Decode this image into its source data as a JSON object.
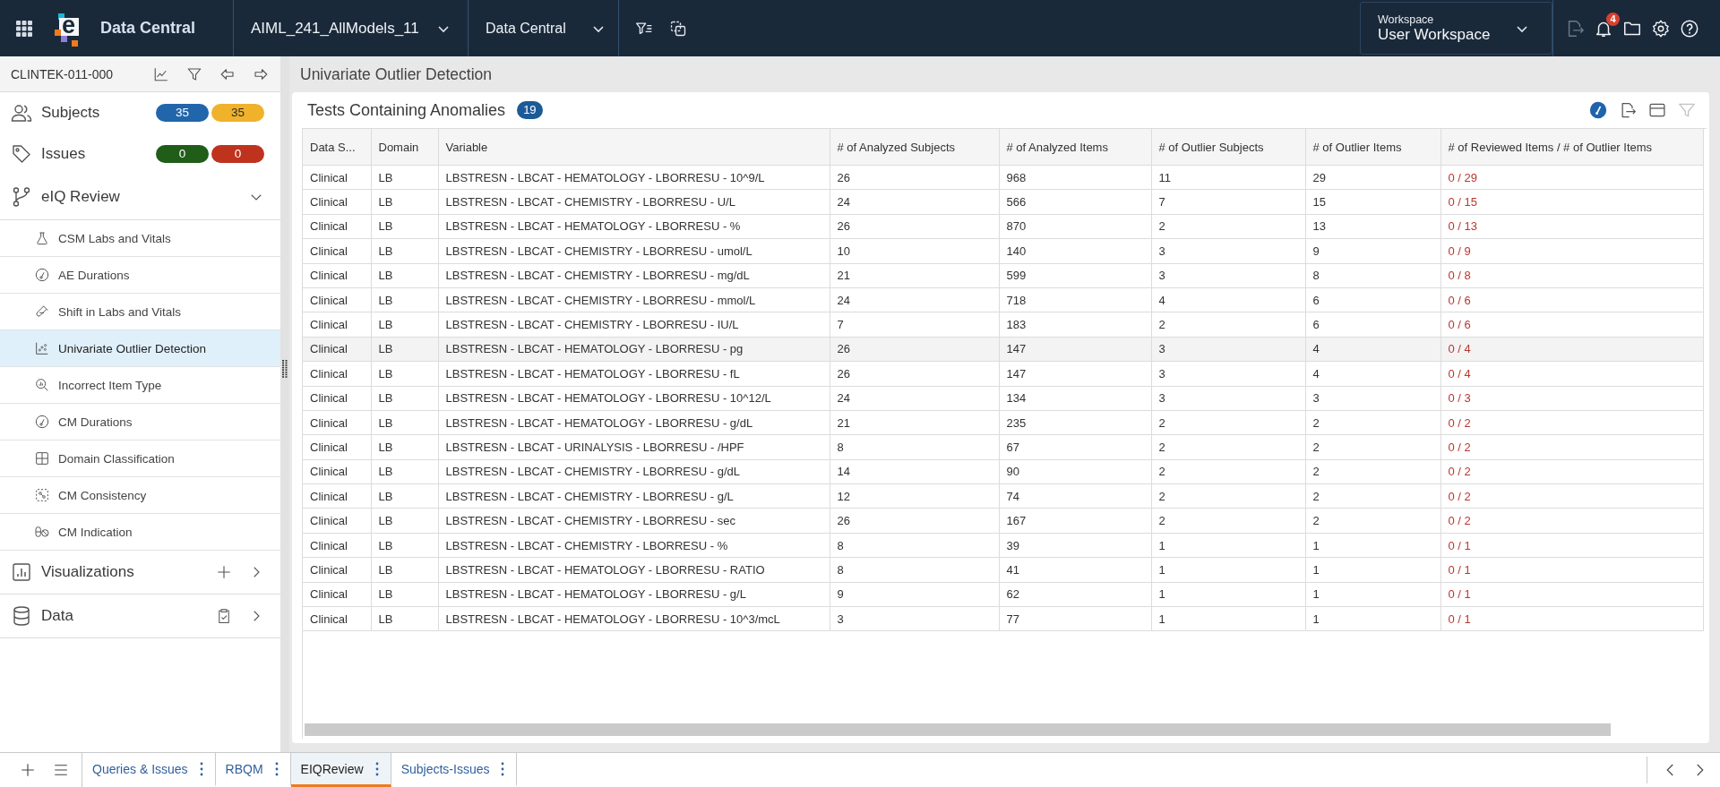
{
  "top_bar": {
    "logo_letter": "e",
    "app_name": "Data Central",
    "project_selector": {
      "value": "AIML_241_AllModels_11"
    },
    "module_selector": {
      "value": "Data Central"
    },
    "workspace": {
      "label": "Workspace",
      "value": "User Workspace"
    },
    "export_disabled": true,
    "notification_count": "4"
  },
  "sidebar": {
    "study_id": "CLINTEK-011-000",
    "sections": [
      {
        "kind": "counts",
        "label": "Subjects",
        "badges": [
          {
            "text": "35",
            "color": "#2166aa"
          },
          {
            "text": "35",
            "color": "#f0b22a"
          }
        ]
      },
      {
        "kind": "counts",
        "label": "Issues",
        "badges": [
          {
            "text": "0",
            "color": "#1f5d19"
          },
          {
            "text": "0",
            "color": "#bf331e"
          }
        ]
      },
      {
        "kind": "group",
        "label": "eIQ Review",
        "expanded": true,
        "children": [
          {
            "label": "CSM Labs and Vitals",
            "selected": false
          },
          {
            "label": "AE Durations",
            "selected": false
          },
          {
            "label": "Shift in Labs and Vitals",
            "selected": false
          },
          {
            "label": "Univariate Outlier Detection",
            "selected": true
          },
          {
            "label": "Incorrect Item Type",
            "selected": false
          },
          {
            "label": "CM Durations",
            "selected": false
          },
          {
            "label": "Domain Classification",
            "selected": false
          },
          {
            "label": "CM Consistency",
            "selected": false
          },
          {
            "label": "CM Indication",
            "selected": false
          }
        ]
      },
      {
        "kind": "link",
        "label": "Visualizations",
        "expanded": false
      },
      {
        "kind": "link",
        "label": "Data",
        "expanded": false
      }
    ]
  },
  "main": {
    "page_title": "Univariate Outlier Detection",
    "card": {
      "title": "Tests Containing Anomalies",
      "count": "19",
      "filter_disabled": true,
      "table": {
        "columns": [
          {
            "label": "Data S...",
            "kind": "text"
          },
          {
            "label": "Domain",
            "kind": "text"
          },
          {
            "label": "Variable",
            "kind": "text"
          },
          {
            "label": "# of Analyzed Subjects",
            "kind": "number"
          },
          {
            "label": "# of Analyzed Items",
            "kind": "number"
          },
          {
            "label": "# of Outlier Subjects",
            "kind": "number"
          },
          {
            "label": "# of Outlier Items",
            "kind": "number"
          },
          {
            "label": "# of Reviewed Items / # of Outlier Items",
            "kind": "ratio"
          }
        ],
        "rows": [
          {
            "hovered": false,
            "cells": [
              "Clinical",
              "LB",
              "LBSTRESN - LBCAT - HEMATOLOGY - LBORRESU - 10^9/L",
              "26",
              "968",
              "11",
              "29",
              "0 / 29"
            ]
          },
          {
            "hovered": false,
            "cells": [
              "Clinical",
              "LB",
              "LBSTRESN - LBCAT - CHEMISTRY - LBORRESU - U/L",
              "24",
              "566",
              "7",
              "15",
              "0 / 15"
            ]
          },
          {
            "hovered": false,
            "cells": [
              "Clinical",
              "LB",
              "LBSTRESN - LBCAT - HEMATOLOGY - LBORRESU - %",
              "26",
              "870",
              "2",
              "13",
              "0 / 13"
            ]
          },
          {
            "hovered": false,
            "cells": [
              "Clinical",
              "LB",
              "LBSTRESN - LBCAT - CHEMISTRY - LBORRESU - umol/L",
              "10",
              "140",
              "3",
              "9",
              "0 / 9"
            ]
          },
          {
            "hovered": false,
            "cells": [
              "Clinical",
              "LB",
              "LBSTRESN - LBCAT - CHEMISTRY - LBORRESU - mg/dL",
              "21",
              "599",
              "3",
              "8",
              "0 / 8"
            ]
          },
          {
            "hovered": false,
            "cells": [
              "Clinical",
              "LB",
              "LBSTRESN - LBCAT - CHEMISTRY - LBORRESU - mmol/L",
              "24",
              "718",
              "4",
              "6",
              "0 / 6"
            ]
          },
          {
            "hovered": false,
            "cells": [
              "Clinical",
              "LB",
              "LBSTRESN - LBCAT - CHEMISTRY - LBORRESU - IU/L",
              "7",
              "183",
              "2",
              "6",
              "0 / 6"
            ]
          },
          {
            "hovered": true,
            "cells": [
              "Clinical",
              "LB",
              "LBSTRESN - LBCAT - HEMATOLOGY - LBORRESU - pg",
              "26",
              "147",
              "3",
              "4",
              "0 / 4"
            ]
          },
          {
            "hovered": false,
            "cells": [
              "Clinical",
              "LB",
              "LBSTRESN - LBCAT - HEMATOLOGY - LBORRESU - fL",
              "26",
              "147",
              "3",
              "4",
              "0 / 4"
            ]
          },
          {
            "hovered": false,
            "cells": [
              "Clinical",
              "LB",
              "LBSTRESN - LBCAT - HEMATOLOGY - LBORRESU - 10^12/L",
              "24",
              "134",
              "3",
              "3",
              "0 / 3"
            ]
          },
          {
            "hovered": false,
            "cells": [
              "Clinical",
              "LB",
              "LBSTRESN - LBCAT - HEMATOLOGY - LBORRESU - g/dL",
              "21",
              "235",
              "2",
              "2",
              "0 / 2"
            ]
          },
          {
            "hovered": false,
            "cells": [
              "Clinical",
              "LB",
              "LBSTRESN - LBCAT - URINALYSIS - LBORRESU - /HPF",
              "8",
              "67",
              "2",
              "2",
              "0 / 2"
            ]
          },
          {
            "hovered": false,
            "cells": [
              "Clinical",
              "LB",
              "LBSTRESN - LBCAT - CHEMISTRY - LBORRESU - g/dL",
              "14",
              "90",
              "2",
              "2",
              "0 / 2"
            ]
          },
          {
            "hovered": false,
            "cells": [
              "Clinical",
              "LB",
              "LBSTRESN - LBCAT - CHEMISTRY - LBORRESU - g/L",
              "12",
              "74",
              "2",
              "2",
              "0 / 2"
            ]
          },
          {
            "hovered": false,
            "cells": [
              "Clinical",
              "LB",
              "LBSTRESN - LBCAT - CHEMISTRY - LBORRESU - sec",
              "26",
              "167",
              "2",
              "2",
              "0 / 2"
            ]
          },
          {
            "hovered": false,
            "cells": [
              "Clinical",
              "LB",
              "LBSTRESN - LBCAT - CHEMISTRY - LBORRESU - %",
              "8",
              "39",
              "1",
              "1",
              "0 / 1"
            ]
          },
          {
            "hovered": false,
            "cells": [
              "Clinical",
              "LB",
              "LBSTRESN - LBCAT - HEMATOLOGY - LBORRESU - RATIO",
              "8",
              "41",
              "1",
              "1",
              "0 / 1"
            ]
          },
          {
            "hovered": false,
            "cells": [
              "Clinical",
              "LB",
              "LBSTRESN - LBCAT - HEMATOLOGY - LBORRESU - g/L",
              "9",
              "62",
              "1",
              "1",
              "0 / 1"
            ]
          },
          {
            "hovered": false,
            "cells": [
              "Clinical",
              "LB",
              "LBSTRESN - LBCAT - HEMATOLOGY - LBORRESU - 10^3/mcL",
              "3",
              "77",
              "1",
              "1",
              "0 / 1"
            ]
          }
        ]
      }
    }
  },
  "bottom_tabs": [
    {
      "label": "Queries & Issues",
      "selected": false
    },
    {
      "label": "RBQM",
      "selected": false
    },
    {
      "label": "EIQReview",
      "selected": true
    },
    {
      "label": "Subjects-Issues",
      "selected": false
    }
  ]
}
